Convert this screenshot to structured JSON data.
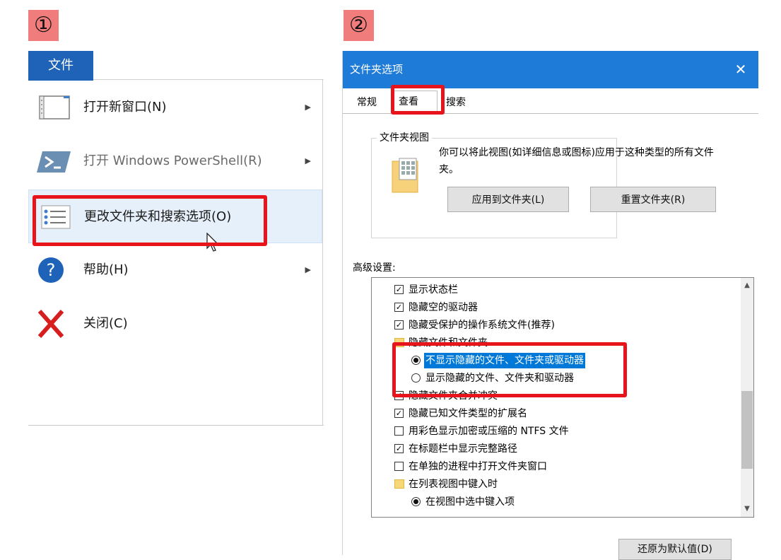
{
  "badges": {
    "step1": "①",
    "step2": "②"
  },
  "left": {
    "file_tab": "文件",
    "items": [
      {
        "label": "打开新窗口(N)",
        "icon": "window-icon",
        "has_submenu": true,
        "disabled": false
      },
      {
        "label": "打开 Windows PowerShell(R)",
        "icon": "powershell-icon",
        "has_submenu": true,
        "disabled": true
      },
      {
        "label": "更改文件夹和搜索选项(O)",
        "icon": "options-list-icon",
        "has_submenu": false,
        "disabled": false,
        "hovered": true
      },
      {
        "label": "帮助(H)",
        "icon": "help-icon",
        "has_submenu": true,
        "disabled": false
      },
      {
        "label": "关闭(C)",
        "icon": "close-x-icon",
        "has_submenu": false,
        "disabled": false
      }
    ],
    "submenu_arrow": "▶"
  },
  "dialog": {
    "title": "文件夹选项",
    "close": "✕",
    "tabs": [
      {
        "label": "常规",
        "active": false
      },
      {
        "label": "查看",
        "active": true
      },
      {
        "label": "搜索",
        "active": false
      }
    ],
    "folder_views": {
      "legend": "文件夹视图",
      "description": "你可以将此视图(如详细信息或图标)应用于这种类型的所有文件夹。",
      "apply_button": "应用到文件夹(L)",
      "reset_button": "重置文件夹(R)"
    },
    "advanced_label": "高级设置:",
    "advanced_items": [
      {
        "type": "checkbox",
        "checked": true,
        "text": "显示状态栏"
      },
      {
        "type": "checkbox",
        "checked": true,
        "text": "隐藏空的驱动器"
      },
      {
        "type": "checkbox",
        "checked": true,
        "text": "隐藏受保护的操作系统文件(推荐)"
      },
      {
        "type": "folder",
        "text": "隐藏文件和文件夹"
      },
      {
        "type": "radio",
        "checked": true,
        "selected": true,
        "text": "不显示隐藏的文件、文件夹或驱动器"
      },
      {
        "type": "radio",
        "checked": false,
        "text": "显示隐藏的文件、文件夹和驱动器"
      },
      {
        "type": "checkbox",
        "checked": true,
        "text": "隐藏文件夹合并冲突"
      },
      {
        "type": "checkbox",
        "checked": true,
        "text": "隐藏已知文件类型的扩展名"
      },
      {
        "type": "checkbox",
        "checked": false,
        "text": "用彩色显示加密或压缩的 NTFS 文件"
      },
      {
        "type": "checkbox",
        "checked": true,
        "text": "在标题栏中显示完整路径"
      },
      {
        "type": "checkbox",
        "checked": false,
        "text": "在单独的进程中打开文件夹窗口"
      },
      {
        "type": "folder",
        "text": "在列表视图中键入时"
      },
      {
        "type": "radio",
        "checked": true,
        "text": "在视图中选中键入项"
      }
    ],
    "restore_button": "还原为默认值(D)",
    "check_mark": "✓",
    "scroll_up": "▲",
    "scroll_down": "▼"
  },
  "colors": {
    "file_tab": "#1e63b8",
    "titlebar": "#1f7bd8",
    "highlight_box": "#e8141b",
    "selection": "#0078d7",
    "badge": "#f07c7c"
  }
}
